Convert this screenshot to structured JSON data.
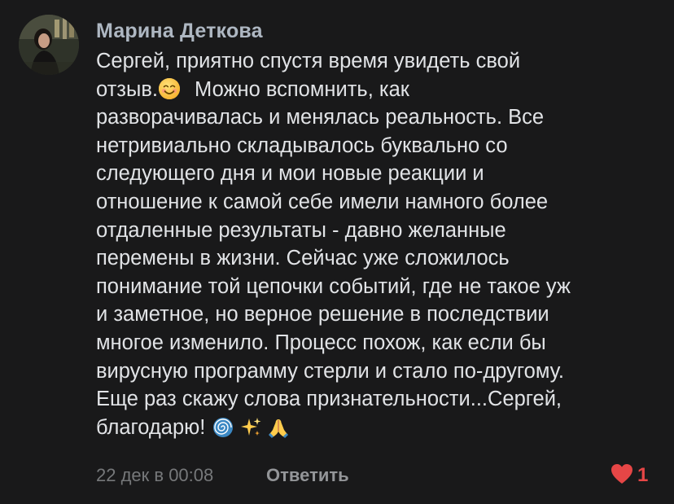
{
  "comment": {
    "author": "Марина Деткова",
    "lines": [
      "Сергей, приятно спустя время увидеть свой",
      "отзыв.",
      " Можно вспомнить, как",
      "разворачивалась и менялась реальность. Все",
      "нетривиально складывалось буквально со",
      "следующего дня и мои новые реакции и",
      "отношение к самой себе имели намного более",
      "отдаленные результаты - давно желанные",
      "перемены в жизни. Сейчас уже сложилось",
      "понимание той цепочки событий, где не такое уж",
      "и заметное, но верное решение в последствии",
      "многое изменило. Процесс похож, как если бы",
      "вирусную программу стерли и стало по-другому.",
      "Еще раз скажу слова признательности...Сергей,",
      "благодарю!"
    ],
    "emojis": [
      "smiling-face-emoji",
      "cyclone-emoji",
      "sparkles-emoji",
      "folded-hands-emoji"
    ],
    "date": "22 дек в 00:08",
    "reply_label": "Ответить",
    "likes": "1",
    "like_color": "#e64646",
    "background": "#19191a"
  }
}
